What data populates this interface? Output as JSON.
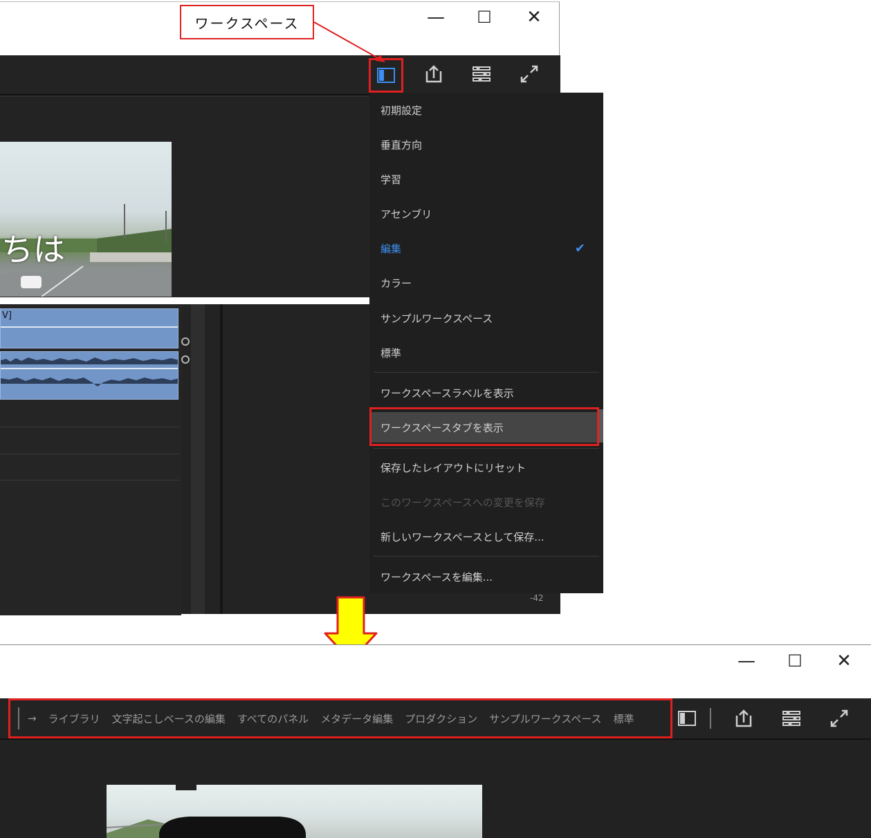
{
  "callout": {
    "label": "ワークスペース"
  },
  "window_controls": {
    "minimize": "—",
    "maximize": "☐",
    "close": "✕"
  },
  "toolbar_icons": [
    "workspace-icon",
    "share-icon",
    "panel-menu-icon",
    "fullscreen-icon"
  ],
  "preview": {
    "overlay_text": "ちは"
  },
  "timeline": {
    "clip_label": "V]"
  },
  "meter": {
    "value": "-42"
  },
  "workspace_menu": {
    "items": [
      {
        "label": "初期設定"
      },
      {
        "label": "垂直方向"
      },
      {
        "label": "学習"
      },
      {
        "label": "アセンブリ"
      },
      {
        "label": "編集",
        "checked": true
      },
      {
        "label": "カラー"
      },
      {
        "label": "サンプルワークスペース"
      },
      {
        "label": "標準"
      }
    ],
    "actions": [
      {
        "label": "ワークスペースラベルを表示"
      },
      {
        "label": "ワークスペースタブを表示",
        "highlighted": true
      }
    ],
    "layout_actions": [
      {
        "label": "保存したレイアウトにリセット"
      },
      {
        "label": "このワークスペースへの変更を保存",
        "disabled": true
      },
      {
        "label": "新しいワークスペースとして保存..."
      }
    ],
    "edit_action": {
      "label": "ワークスペースを編集..."
    }
  },
  "workspace_tabs": {
    "overflow": "→",
    "tabs": [
      "ライブラリ",
      "文字起こしベースの編集",
      "すべてのパネル",
      "メタデータ編集",
      "プロダクション",
      "サンプルワークスペース",
      "標準"
    ]
  },
  "colors": {
    "accent_blue": "#3d8ef0",
    "highlight_red": "#e02020",
    "arrow_yellow": "#ffff00",
    "panel_bg": "#232323"
  }
}
